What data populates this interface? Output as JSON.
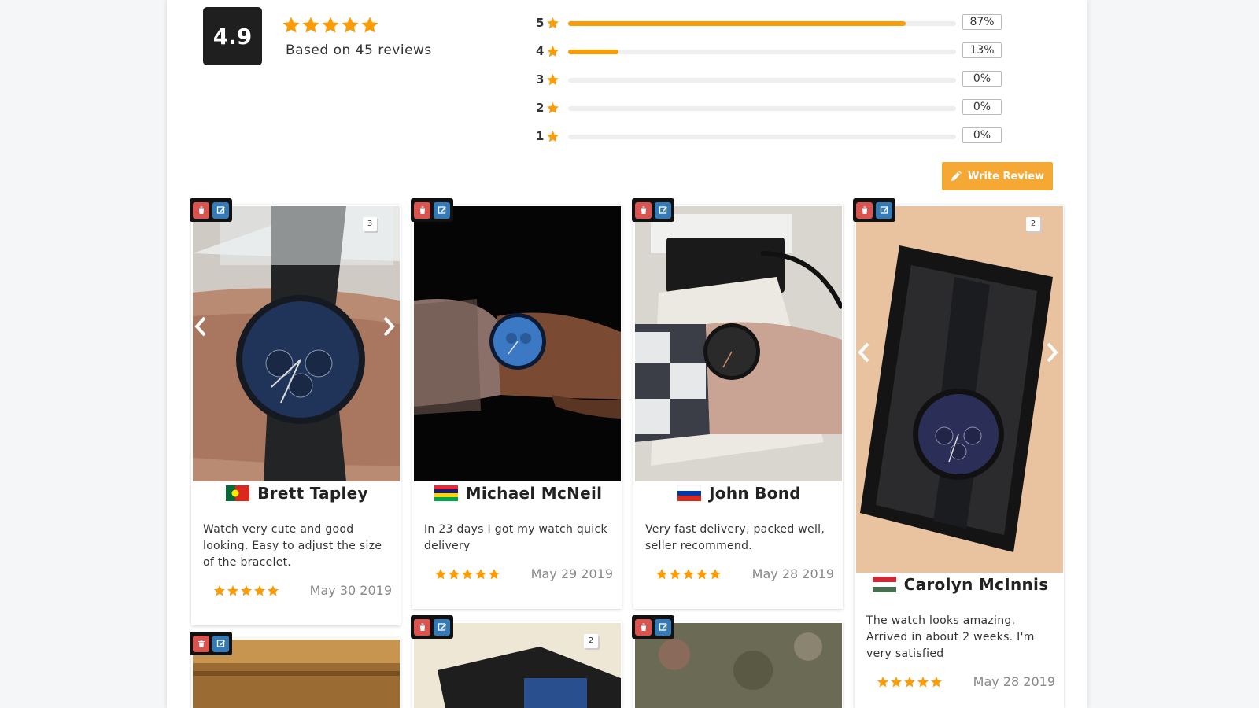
{
  "summary": {
    "score": "4.9",
    "based_on": "Based on 45 reviews",
    "rating": 5
  },
  "distribution": [
    {
      "stars": "5",
      "percent": 87,
      "label": "87%"
    },
    {
      "stars": "4",
      "percent": 13,
      "label": "13%"
    },
    {
      "stars": "3",
      "percent": 0,
      "label": "0%"
    },
    {
      "stars": "2",
      "percent": 0,
      "label": "0%"
    },
    {
      "stars": "1",
      "percent": 0,
      "label": "0%"
    }
  ],
  "write_review_label": "Write Review",
  "colors": {
    "accent": "#fb9b06",
    "button": "#f5a934",
    "delete": "#d9534f",
    "edit": "#337ab7"
  },
  "icons": {
    "delete": "trash-icon",
    "edit": "edit-icon",
    "star": "star-icon",
    "write": "pencil-icon"
  },
  "reviews": [
    {
      "name": "Brett Tapley",
      "country_flag": "portugal-flag",
      "text": "Watch very cute and good looking. Easy to adjust the size of the bracelet.",
      "date": "May 30 2019",
      "rating": 5,
      "photo_count": "3"
    },
    {
      "name": "Michael McNeil",
      "country_flag": "mauritius-flag",
      "text": "In 23 days I got my watch quick delivery",
      "date": "May 29 2019",
      "rating": 5,
      "photo_count": ""
    },
    {
      "name": "John Bond",
      "country_flag": "russia-flag",
      "text": "Very fast delivery, packed well, seller recommend.",
      "date": "May 28 2019",
      "rating": 5,
      "photo_count": ""
    },
    {
      "name": "Carolyn McInnis",
      "country_flag": "hungary-flag",
      "text": "The watch looks amazing. Arrived in about 2 weeks. I'm very satisfied",
      "date": "May 28 2019",
      "rating": 5,
      "photo_count": "2"
    }
  ],
  "second_row": [
    {
      "photo_count": ""
    },
    {
      "photo_count": "2"
    },
    {
      "photo_count": ""
    }
  ]
}
